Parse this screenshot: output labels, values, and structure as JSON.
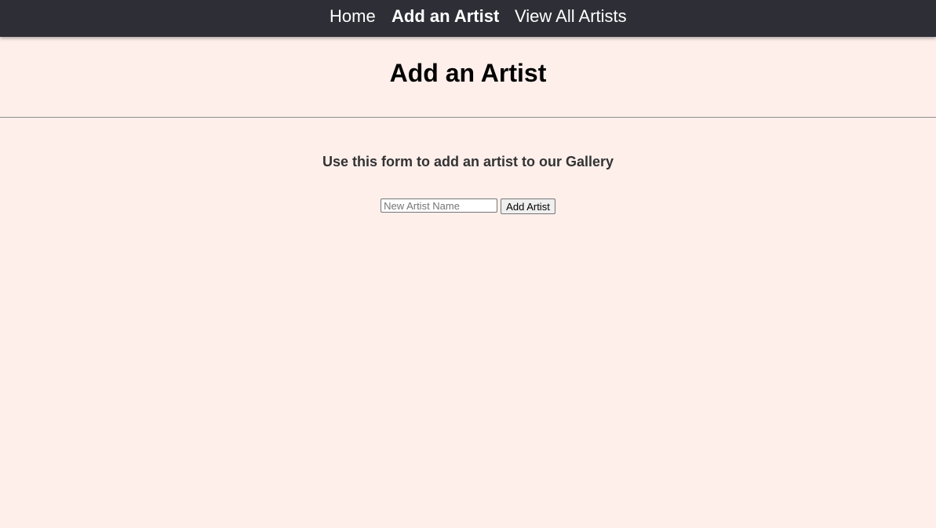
{
  "nav": {
    "items": [
      {
        "label": "Home",
        "active": false
      },
      {
        "label": "Add an Artist",
        "active": true
      },
      {
        "label": "View All Artists",
        "active": false
      }
    ]
  },
  "page": {
    "title": "Add an Artist",
    "instructions": "Use this form to add an artist to our Gallery"
  },
  "form": {
    "artist_name_placeholder": "New Artist Name",
    "artist_name_value": "",
    "submit_label": "Add Artist"
  },
  "colors": {
    "background": "#FEEFEB",
    "nav_background": "#2E2E36",
    "nav_text": "#FFFFFF"
  }
}
